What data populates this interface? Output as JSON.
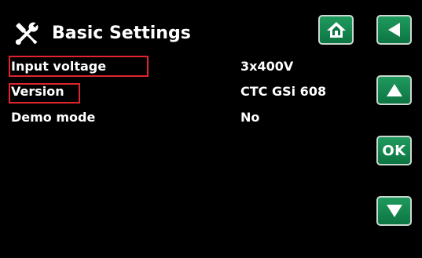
{
  "header": {
    "title": "Basic Settings",
    "icon": "tools-icon"
  },
  "nav": {
    "home_icon": "home-icon",
    "back_icon": "back-arrow-icon",
    "up_icon": "up-arrow-icon",
    "ok_label": "OK",
    "down_icon": "down-arrow-icon"
  },
  "settings": [
    {
      "label": "Input voltage",
      "value": "3x400V"
    },
    {
      "label": "Version",
      "value": "CTC GSi 608"
    },
    {
      "label": "Demo mode",
      "value": "No"
    }
  ],
  "colors": {
    "background": "#000000",
    "button": "#128250",
    "button_border": "#c9d9cf",
    "highlight": "#e0242d",
    "text": "#ffffff"
  }
}
